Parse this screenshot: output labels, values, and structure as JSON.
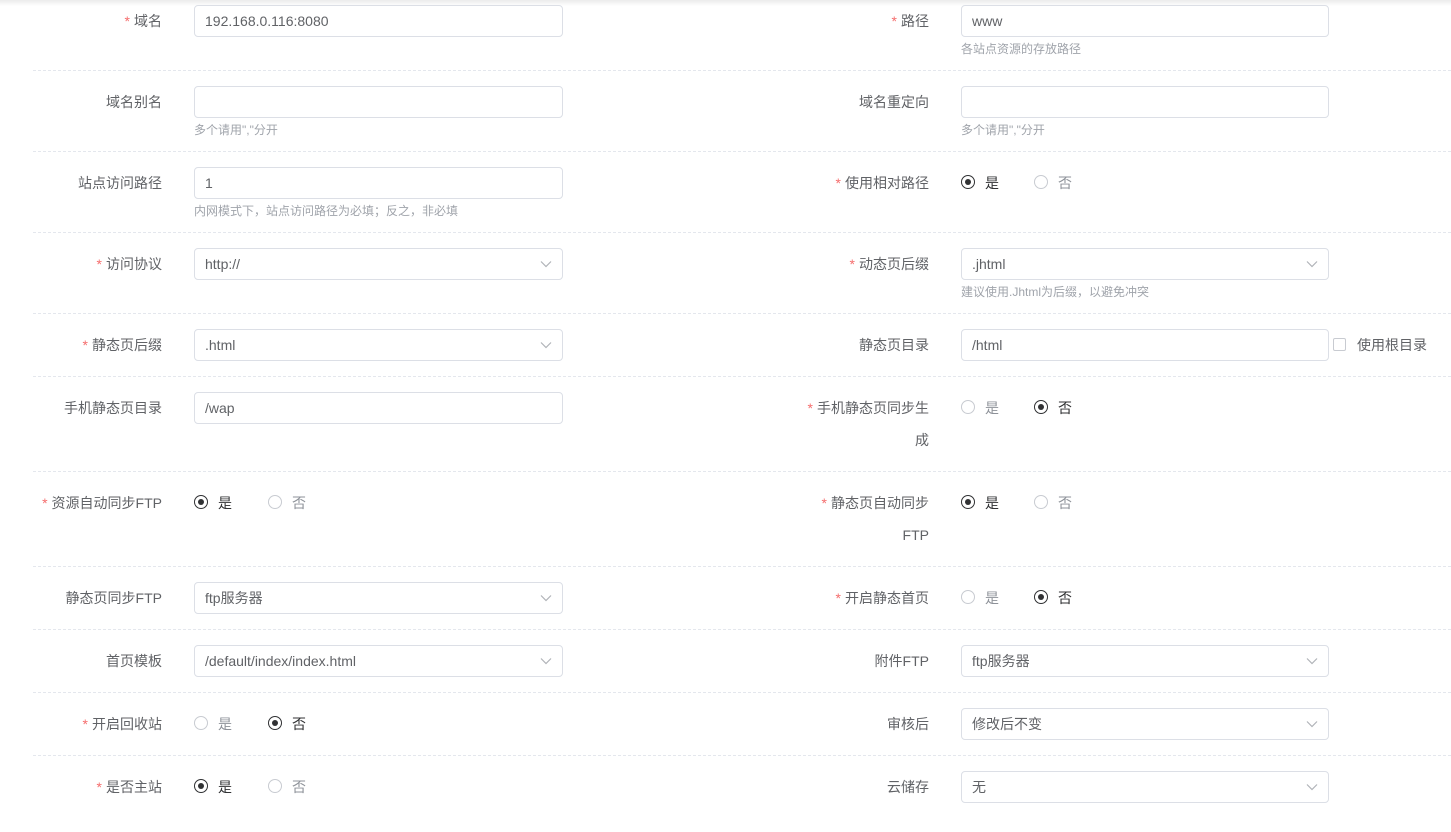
{
  "form": {
    "domain": {
      "label": "域名",
      "value": "192.168.0.116:8080"
    },
    "path": {
      "label": "路径",
      "value": "www",
      "hint": "各站点资源的存放路径"
    },
    "domain_alias": {
      "label": "域名别名",
      "value": "",
      "hint": "多个请用\",\"分开"
    },
    "domain_redirect": {
      "label": "域名重定向",
      "value": "",
      "hint": "多个请用\",\"分开"
    },
    "site_access_path": {
      "label": "站点访问路径",
      "value": "1",
      "hint": "内网模式下，站点访问路径为必填；反之，非必填"
    },
    "use_relative_path": {
      "label": "使用相对路径",
      "options": [
        "是",
        "否"
      ],
      "selected": "是"
    },
    "protocol": {
      "label": "访问协议",
      "value": "http://"
    },
    "dynamic_suffix": {
      "label": "动态页后缀",
      "value": ".jhtml",
      "hint": "建议使用.Jhtml为后缀，以避免冲突"
    },
    "static_suffix": {
      "label": "静态页后缀",
      "value": ".html"
    },
    "static_dir": {
      "label": "静态页目录",
      "value": "/html",
      "checkbox_label": "使用根目录",
      "checked": false
    },
    "mobile_static_dir": {
      "label": "手机静态页目录",
      "value": "/wap"
    },
    "mobile_static_sync": {
      "label_line1": "手机静态页同步生",
      "label_line2": "成",
      "options": [
        "是",
        "否"
      ],
      "selected": "否"
    },
    "resource_sync_ftp": {
      "label": "资源自动同步FTP",
      "options": [
        "是",
        "否"
      ],
      "selected": "是"
    },
    "static_sync_ftp_auto": {
      "label_line1": "静态页自动同步",
      "label_line2": "FTP",
      "options": [
        "是",
        "否"
      ],
      "selected": "是"
    },
    "static_sync_ftp": {
      "label": "静态页同步FTP",
      "value": "ftp服务器"
    },
    "enable_static_home": {
      "label": "开启静态首页",
      "options": [
        "是",
        "否"
      ],
      "selected": "否"
    },
    "home_template": {
      "label": "首页模板",
      "value": "/default/index/index.html"
    },
    "attachment_ftp": {
      "label": "附件FTP",
      "value": "ftp服务器"
    },
    "enable_recycle": {
      "label": "开启回收站",
      "options": [
        "是",
        "否"
      ],
      "selected": "否"
    },
    "after_review": {
      "label": "审核后",
      "value": "修改后不变"
    },
    "is_main_site": {
      "label": "是否主站",
      "options": [
        "是",
        "否"
      ],
      "selected": "是"
    },
    "cloud_storage": {
      "label": "云储存",
      "value": "无"
    }
  },
  "required_mark": "*",
  "icons": {
    "select_arrow": "chevron-down-icon",
    "radio": "radio-circle-icon",
    "checkbox": "checkbox-square-icon"
  }
}
